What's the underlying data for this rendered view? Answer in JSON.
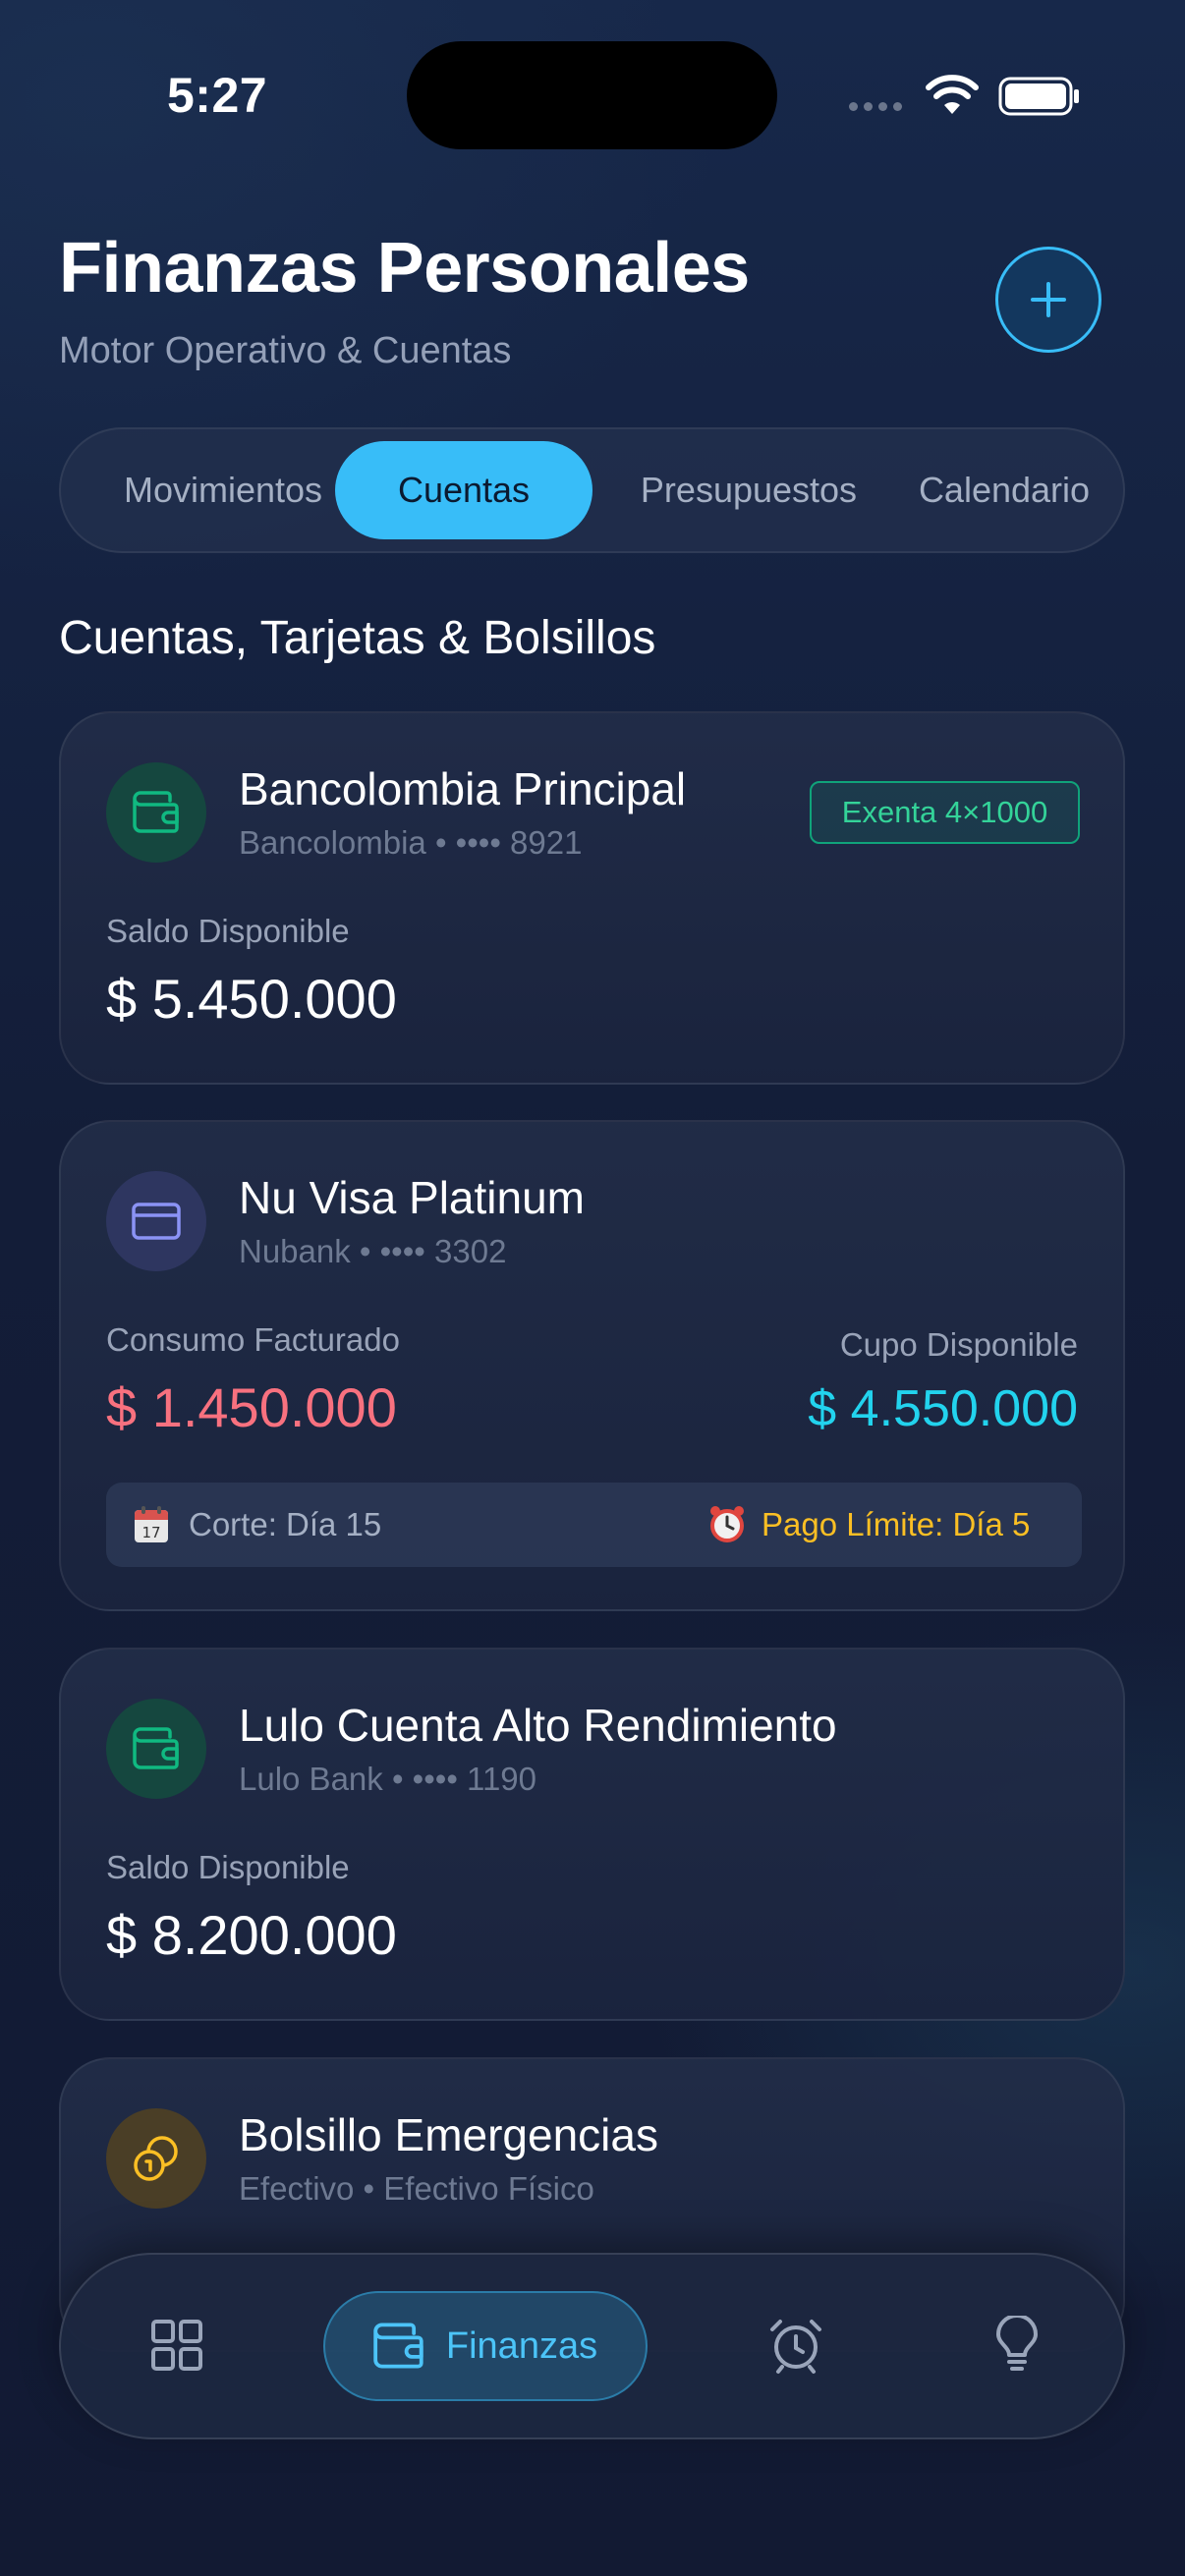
{
  "status_bar": {
    "time": "5:27"
  },
  "header": {
    "title": "Finanzas Personales",
    "subtitle": "Motor Operativo & Cuentas",
    "add_icon": "plus-icon"
  },
  "tabs": [
    {
      "label": "Movimientos",
      "active": false
    },
    {
      "label": "Cuentas",
      "active": true
    },
    {
      "label": "Presupuestos",
      "active": false
    },
    {
      "label": "Calendario",
      "active": false
    }
  ],
  "section_title": "Cuentas, Tarjetas & Bolsillos",
  "accounts": [
    {
      "name": "Bancolombia Principal",
      "subtitle": "Bancolombia • •••• 8921",
      "icon": "wallet-icon",
      "badge": "Exenta 4×1000",
      "balance_label": "Saldo Disponible",
      "balance": "$ 5.450.000"
    },
    {
      "name": "Nu Visa Platinum",
      "subtitle": "Nubank • •••• 3302",
      "icon": "credit-card-icon",
      "billed_label": "Consumo Facturado",
      "billed": "$ 1.450.000",
      "available_label": "Cupo Disponible",
      "available": "$ 4.550.000",
      "cutoff_icon": "calendar-icon",
      "cutoff": "Corte: Día 15",
      "due_icon": "alarm-clock-icon",
      "due": "Pago Límite: Día 5"
    },
    {
      "name": "Lulo Cuenta Alto Rendimiento",
      "subtitle": "Lulo Bank • •••• 1190",
      "icon": "wallet-icon",
      "balance_label": "Saldo Disponible",
      "balance": "$ 8.200.000"
    },
    {
      "name": "Bolsillo Emergencias",
      "subtitle": "Efectivo • Efectivo Físico",
      "icon": "coins-icon"
    }
  ],
  "bottom_nav": [
    {
      "icon": "dashboard-grid-icon",
      "label": "",
      "active": false
    },
    {
      "icon": "wallet-icon",
      "label": "Finanzas",
      "active": true
    },
    {
      "icon": "alarm-clock-icon",
      "label": "",
      "active": false
    },
    {
      "icon": "lightbulb-icon",
      "label": "",
      "active": false
    }
  ],
  "colors": {
    "accent": "#38bdf8",
    "negative": "#f8717f",
    "positive_cyan": "#22d3ee",
    "warning": "#fbbf24",
    "success": "#34d399"
  }
}
